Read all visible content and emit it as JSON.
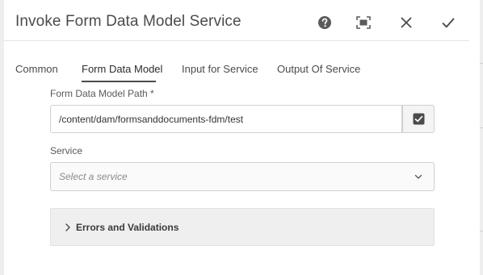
{
  "dialog": {
    "title": "Invoke Form Data Model Service",
    "actions": {
      "help_icon": "help-icon",
      "fullscreen_icon": "fullscreen-icon",
      "close_icon": "close-icon",
      "done_icon": "checkmark-icon"
    }
  },
  "tabs": [
    {
      "label": "Common",
      "active": false
    },
    {
      "label": "Form Data Model",
      "active": true
    },
    {
      "label": "Input for Service",
      "active": false
    },
    {
      "label": "Output Of Service",
      "active": false
    }
  ],
  "form": {
    "fdm_path": {
      "label": "Form Data Model Path *",
      "value": "/content/dam/formsanddocuments-fdm/test",
      "picker_icon": "checkbox-checked-icon"
    },
    "service": {
      "label": "Service",
      "placeholder": "Select a service",
      "icon": "chevron-down-icon"
    },
    "errors": {
      "label": "Errors and Validations",
      "expanded": false,
      "icon": "chevron-right-icon"
    }
  },
  "colors": {
    "text": "#4b4b4b",
    "border": "#d0d0d0",
    "accordion_bg": "#efefef",
    "active_tab_underline": "#4b4b4b"
  }
}
